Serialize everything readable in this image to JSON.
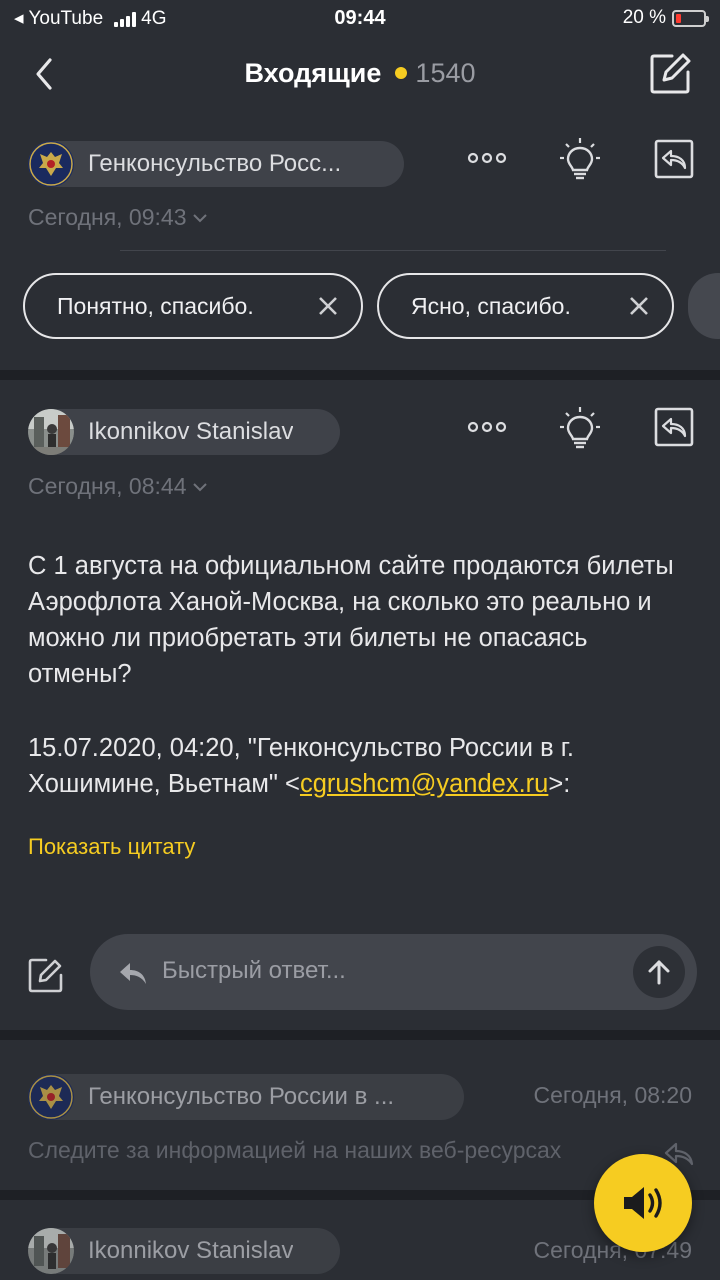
{
  "status_bar": {
    "back_app": "◂ YouTube",
    "network": "4G",
    "time": "09:44",
    "battery_percent": "20 %",
    "battery_level": 0.2
  },
  "header": {
    "title": "Входящие",
    "unread_count": "1540"
  },
  "messages": [
    {
      "sender": "Генконсульство Росс...",
      "date": "Сегодня, 09:43",
      "quick_replies": [
        "Понятно, спасибо.",
        "Ясно, спасибо."
      ]
    },
    {
      "sender": "Ikonnikov Stanislav",
      "date": "Сегодня, 08:44",
      "body": "С 1 августа на официальном сайте продаются билеты Аэрофлота Ханой-Москва, на сколько это реально и можно ли приобретать эти билеты не опасаясь отмены?",
      "quote_header_prefix": "15.07.2020, 04:20, \"Генконсульство России в г. Хошимине, Вьетнам\" <",
      "quote_header_email": "cgrushcm@yandex.ru",
      "quote_header_suffix": ">:",
      "show_quote": "Показать цитату",
      "reply_placeholder": "Быстрый ответ..."
    },
    {
      "sender": "Генконсульство России в ...",
      "time": "Сегодня, 08:20",
      "preview": "Следите за информацией на наших веб-ресурсах"
    },
    {
      "sender": "Ikonnikov Stanislav",
      "time": "Сегодня, 07:49"
    }
  ],
  "colors": {
    "accent": "#f6cc21",
    "background": "#2b2e34",
    "separator": "#1e2025",
    "chip": "#3f4249"
  },
  "icons": [
    "back-icon",
    "compose-icon",
    "more-icon",
    "bulb-icon",
    "reply-all-icon",
    "close-icon",
    "edit-icon",
    "reply-arrow-icon",
    "send-arrow-icon",
    "speaker-icon",
    "coat-of-arms-icon"
  ]
}
